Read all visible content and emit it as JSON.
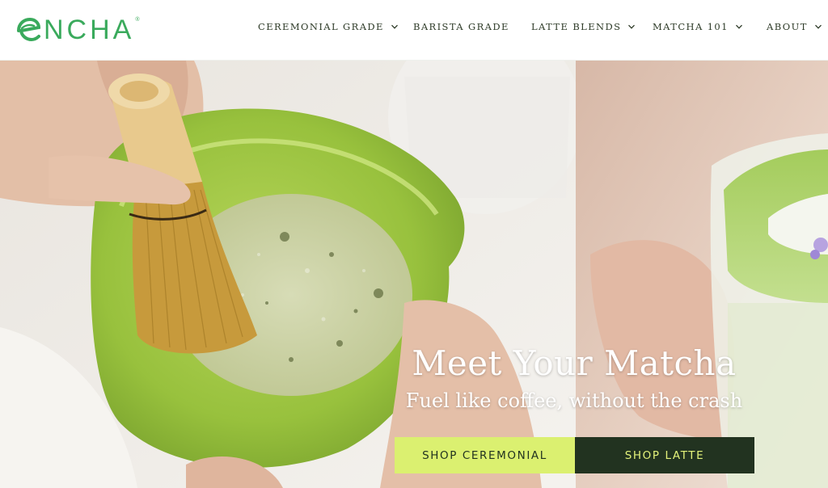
{
  "brand": {
    "name": "NCHA",
    "registered": "®",
    "color": "#3aaa5c"
  },
  "nav": {
    "items": [
      {
        "label": "CEREMONIAL GRADE",
        "has_dropdown": true
      },
      {
        "label": "BARISTA GRADE",
        "has_dropdown": false
      },
      {
        "label": "LATTE BLENDS",
        "has_dropdown": true
      },
      {
        "label": "MATCHA 101",
        "has_dropdown": true
      },
      {
        "label": "ABOUT",
        "has_dropdown": true
      }
    ],
    "chevron_icon": "chevron-down-icon",
    "text_color": "#2d3a27"
  },
  "hero": {
    "title": "Meet Your Matcha",
    "subtitle": "Fuel like coffee, without the crash",
    "buttons": {
      "ceremonial": "SHOP CEREMONIAL",
      "latte": "SHOP LATTE"
    },
    "colors": {
      "ceremonial_bg": "#dbf070",
      "latte_bg": "#223320"
    }
  }
}
